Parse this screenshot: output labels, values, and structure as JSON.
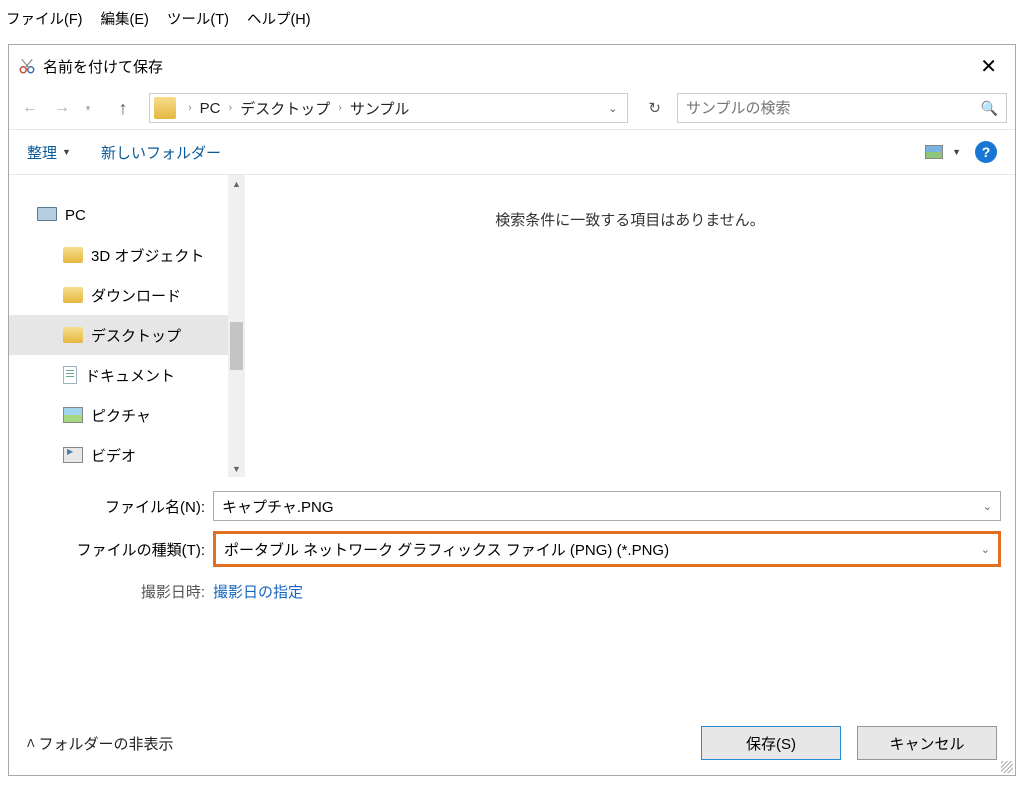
{
  "appMenu": {
    "file": "ファイル(F)",
    "edit": "編集(E)",
    "tool": "ツール(T)",
    "help": "ヘルプ(H)"
  },
  "dialog": {
    "title": "名前を付けて保存",
    "breadcrumbs": [
      "PC",
      "デスクトップ",
      "サンプル"
    ],
    "searchPlaceholder": "サンプルの検索",
    "toolbar": {
      "organize": "整理",
      "newFolder": "新しいフォルダー"
    },
    "tree": {
      "root": "PC",
      "items": [
        {
          "label": "3D オブジェクト",
          "kind": "folder"
        },
        {
          "label": "ダウンロード",
          "kind": "folder"
        },
        {
          "label": "デスクトップ",
          "kind": "folder",
          "selected": true
        },
        {
          "label": "ドキュメント",
          "kind": "doc"
        },
        {
          "label": "ピクチャ",
          "kind": "pic"
        },
        {
          "label": "ビデオ",
          "kind": "vid"
        }
      ]
    },
    "emptyMsg": "検索条件に一致する項目はありません。",
    "form": {
      "fileNameLabel": "ファイル名(N):",
      "fileNameValue": "キャプチャ.PNG",
      "fileTypeLabel": "ファイルの種類(T):",
      "fileTypeValue": "ポータブル ネットワーク グラフィックス ファイル (PNG) (*.PNG)",
      "dateLabel": "撮影日時:",
      "dateLink": "撮影日の指定"
    },
    "footer": {
      "hideFolders": "フォルダーの非表示",
      "save": "保存(S)",
      "cancel": "キャンセル"
    }
  }
}
